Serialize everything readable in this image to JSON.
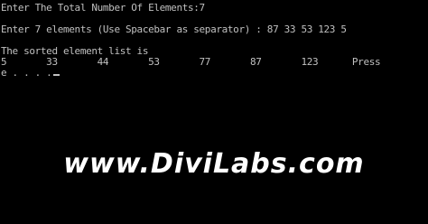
{
  "console": {
    "line_prompt_total": "Enter The Total Number Of Elements:7",
    "line_prompt_elements": "Enter 7 elements (Use Spacebar as separator) : 87 33 53 123 5",
    "line_sorted_header": "The sorted element list is",
    "line_sorted_values": "5       33       44       53       77       87       123      Press",
    "line_continuation": "e . . . ."
  },
  "watermark": {
    "text": "www.DiviLabs.com"
  },
  "colors": {
    "background": "#000000",
    "console_text": "#c0c0c0",
    "watermark": "#ffffff"
  }
}
